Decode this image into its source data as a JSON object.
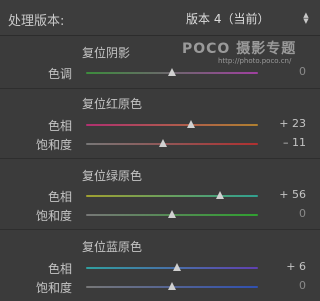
{
  "header": {
    "label": "处理版本:",
    "version_value": "版本 4（当前）"
  },
  "watermark": {
    "brand": "POCO 摄影专题",
    "url": "http://photo.poco.cn/"
  },
  "sections": [
    {
      "title": "复位阴影",
      "rows": [
        {
          "label": "色调",
          "value": "0",
          "level": 0.5,
          "gradient": [
            "#3c8c3c",
            "#a040a0"
          ]
        }
      ]
    },
    {
      "title": "复位红原色",
      "rows": [
        {
          "label": "色相",
          "value": "+ 23",
          "level": 0.61,
          "gradient": [
            "#b03070",
            "#b08030"
          ]
        },
        {
          "label": "饱和度",
          "value": "– 11",
          "level": 0.45,
          "gradient": [
            "#777777",
            "#b03030"
          ]
        }
      ]
    },
    {
      "title": "复位绿原色",
      "rows": [
        {
          "label": "色相",
          "value": "+ 56",
          "level": 0.78,
          "gradient": [
            "#a0a030",
            "#30a090"
          ]
        },
        {
          "label": "饱和度",
          "value": "0",
          "level": 0.5,
          "gradient": [
            "#777777",
            "#30a030"
          ]
        }
      ]
    },
    {
      "title": "复位蓝原色",
      "rows": [
        {
          "label": "色相",
          "value": "+ 6",
          "level": 0.53,
          "gradient": [
            "#30a0a0",
            "#6040b0"
          ]
        },
        {
          "label": "饱和度",
          "value": "0",
          "level": 0.5,
          "gradient": [
            "#777777",
            "#3050b0"
          ]
        }
      ]
    }
  ]
}
